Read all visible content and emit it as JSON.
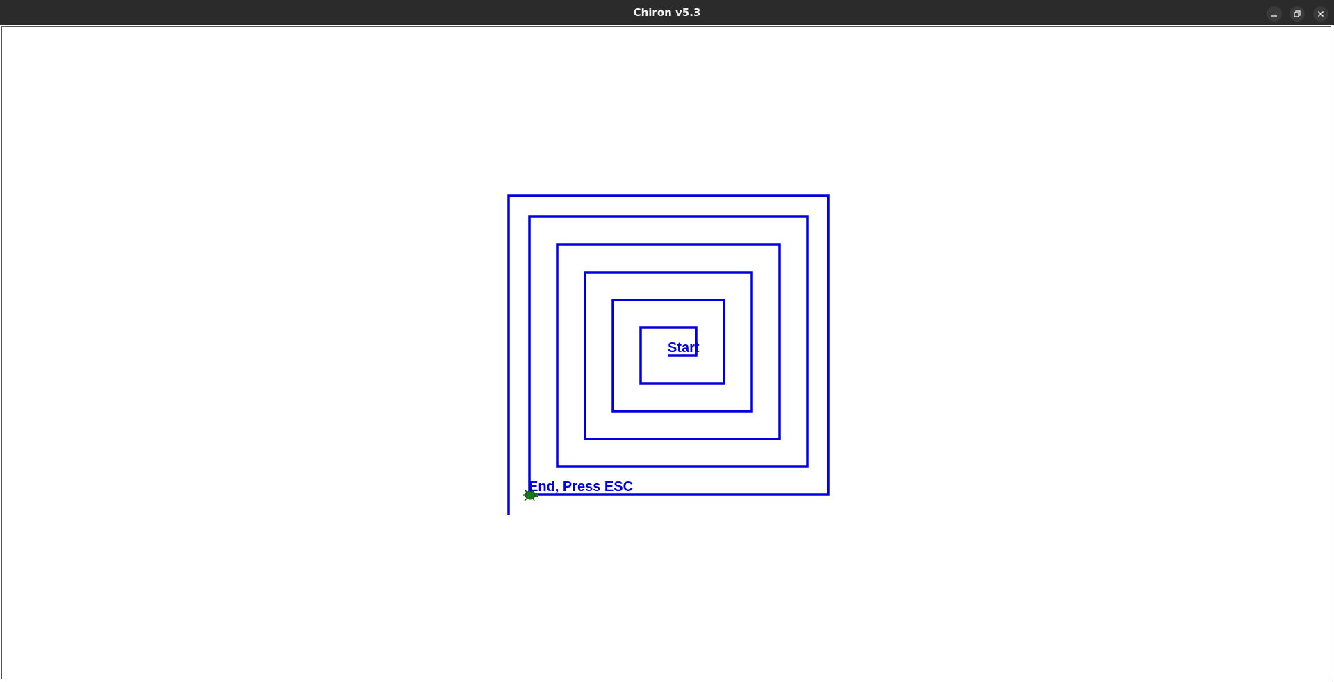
{
  "window": {
    "title": "Chiron v5.3",
    "controls": {
      "minimize_icon": "minimize-icon",
      "maximize_icon": "restore-icon",
      "close_icon": "close-icon"
    }
  },
  "canvas": {
    "pen_color": "#0000dd",
    "background": "#ffffff",
    "labels": {
      "start": "Start",
      "end": "End, Press ESC"
    },
    "turtle": {
      "icon": "turtle-icon",
      "color": "#1a7a1a"
    }
  }
}
